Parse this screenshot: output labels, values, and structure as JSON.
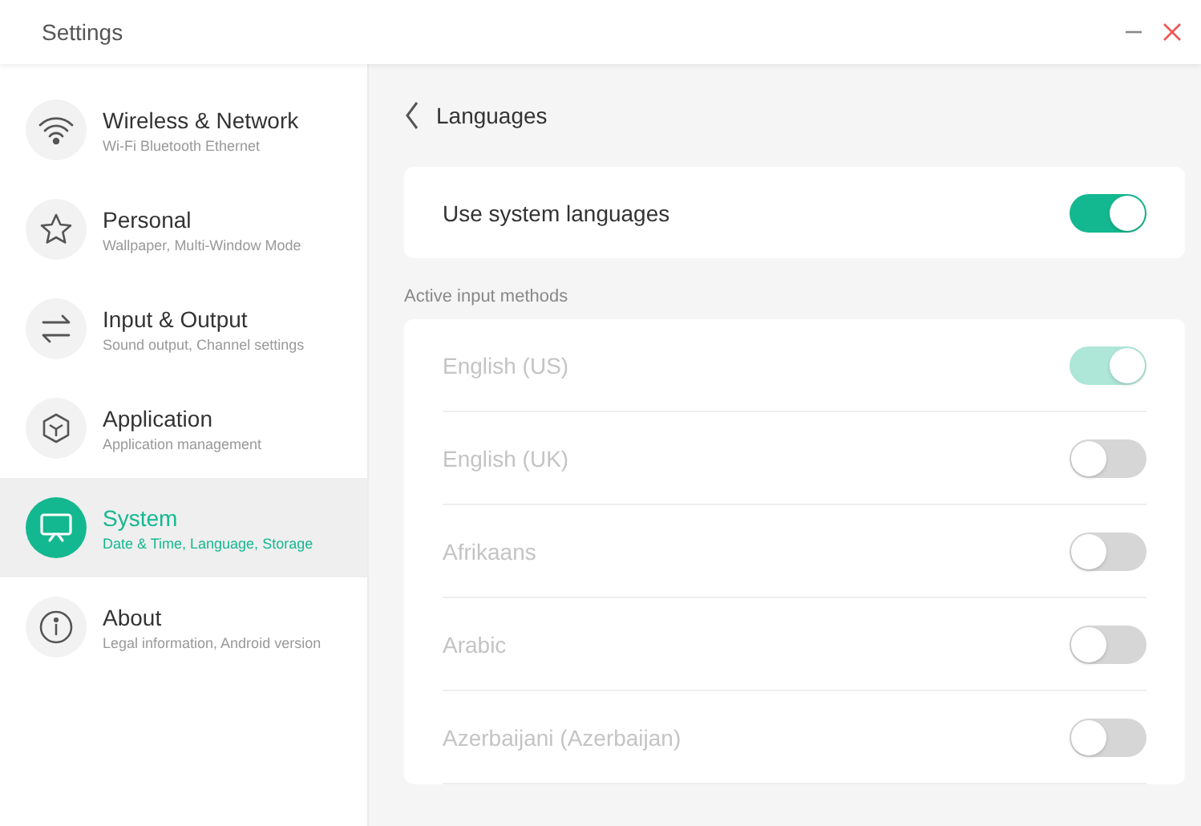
{
  "window": {
    "title": "Settings"
  },
  "sidebar": {
    "items": [
      {
        "title": "Wireless & Network",
        "subtitle": "Wi-Fi Bluetooth Ethernet",
        "selected": false
      },
      {
        "title": "Personal",
        "subtitle": "Wallpaper, Multi-Window Mode",
        "selected": false
      },
      {
        "title": "Input & Output",
        "subtitle": "Sound output, Channel settings",
        "selected": false
      },
      {
        "title": "Application",
        "subtitle": "Application management",
        "selected": false
      },
      {
        "title": "System",
        "subtitle": "Date & Time, Language, Storage",
        "selected": true
      },
      {
        "title": "About",
        "subtitle": "Legal information, Android version",
        "selected": false
      }
    ]
  },
  "page": {
    "title": "Languages"
  },
  "system_languages": {
    "label": "Use system languages",
    "on": true
  },
  "input_methods": {
    "heading": "Active input methods",
    "disabled": true,
    "items": [
      {
        "label": "English (US)",
        "on": true
      },
      {
        "label": "English (UK)",
        "on": false
      },
      {
        "label": "Afrikaans",
        "on": false
      },
      {
        "label": "Arabic",
        "on": false
      },
      {
        "label": "Azerbaijani (Azerbaijan)",
        "on": false
      }
    ]
  }
}
